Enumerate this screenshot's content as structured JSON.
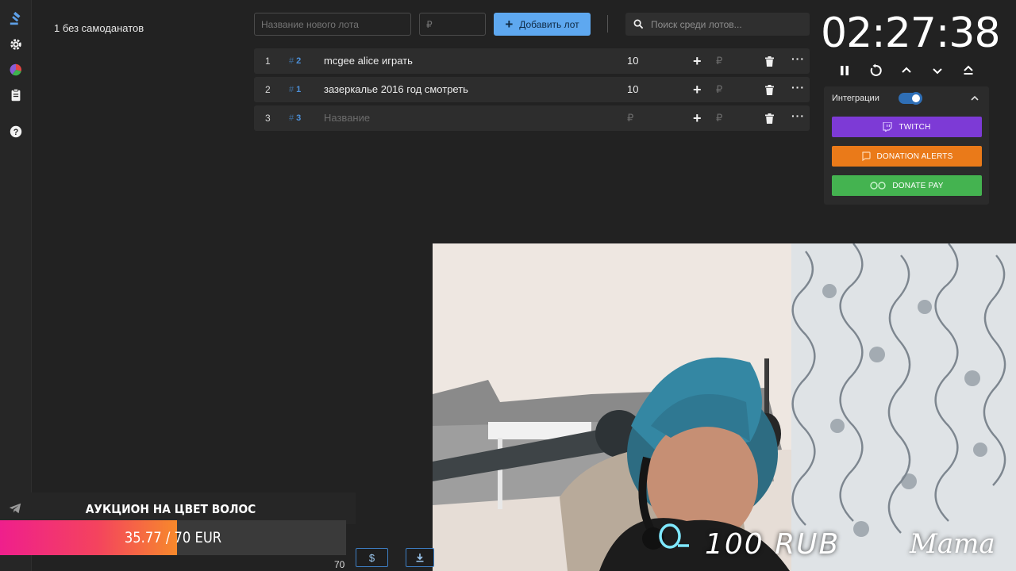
{
  "sidebar": {
    "items": [
      {
        "icon": "gavel-icon"
      },
      {
        "icon": "gear-icon"
      },
      {
        "icon": "pie-chart-icon"
      },
      {
        "icon": "clipboard-icon"
      },
      {
        "icon": "help-icon"
      }
    ]
  },
  "counter_text": "1 без самоданатов",
  "form": {
    "name_placeholder": "Название нового лота",
    "amount_placeholder": "₽",
    "add_label": "Добавить лот",
    "search_placeholder": "Поиск среди лотов..."
  },
  "lots": [
    {
      "num": "1",
      "id": "2",
      "name": "mcgee alice играть",
      "amount": "10",
      "rub": "₽"
    },
    {
      "num": "2",
      "id": "1",
      "name": "зазеркалье 2016 год смотреть",
      "amount": "10",
      "rub": "₽"
    },
    {
      "num": "3",
      "id": "3",
      "name": "Название",
      "amount": "₽",
      "rub": "₽"
    }
  ],
  "lot_hash": "#",
  "timer": {
    "value": "02:27:38"
  },
  "integrations": {
    "label": "Интеграции",
    "enabled": true,
    "twitch": "TWITCH",
    "donation_alerts": "DONATION ALERTS",
    "donate_pay": "DONATE PAY",
    "colors": {
      "twitch": "#7d3ad6",
      "donation_alerts": "#ea7a19",
      "donate_pay": "#44b350"
    }
  },
  "overlay": {
    "title": "АУКЦИОН НА ЦВЕТ ВОЛОС",
    "progress_text": "35.77 / 70 EUR",
    "progress_fraction": 0.511
  },
  "bottom": {
    "dollar_label": "$",
    "value_label": "70"
  },
  "webcam": {
    "donation_text": "100 RUB",
    "corner_text": "Mama"
  }
}
